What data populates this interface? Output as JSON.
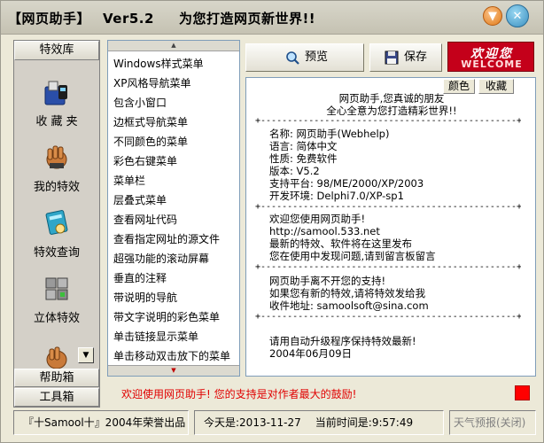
{
  "window": {
    "app_name": "【网页助手】",
    "version": "Ver5.2",
    "slogan": "为您打造网页新世界!!"
  },
  "sidebar": {
    "header": "特效库",
    "items": [
      {
        "label": "收 藏 夹",
        "icon": "phone-book-icon"
      },
      {
        "label": "我的特效",
        "icon": "hand-open-icon"
      },
      {
        "label": "特效查询",
        "icon": "book-search-icon"
      },
      {
        "label": "立体特效",
        "icon": "cubes-icon"
      },
      {
        "label": "",
        "icon": "hand-partial-icon"
      }
    ],
    "footer_buttons": [
      "帮助箱",
      "工具箱"
    ]
  },
  "effect_list": {
    "items": [
      "Windows样式菜单",
      "XP风格导航菜单",
      "包含小窗口",
      "边框式导航菜单",
      "不同颜色的菜单",
      "彩色右键菜单",
      "菜单栏",
      "层叠式菜单",
      "查看网址代码",
      "查看指定网址的源文件",
      "超强功能的滚动屏幕",
      "垂直的注释",
      "带说明的导航",
      "带文字说明的彩色菜单",
      "单击链接显示菜单",
      "单击移动双击放下的菜单"
    ]
  },
  "toolbar": {
    "preview_label": "预览",
    "save_label": "保存",
    "banner_text": "欢迎您",
    "banner_sub": "WELCOME"
  },
  "panel": {
    "tabs": [
      "颜色",
      "收藏"
    ],
    "separator": "+------------------------------------------------+",
    "intro": [
      "网页助手,您真诚的朋友",
      "全心全意为您打造精彩世界!!"
    ],
    "info": [
      "名称: 网页助手(Webhelp)",
      "语言: 简体中文",
      "性质: 免费软件",
      "版本: V5.2",
      "支持平台: 98/ME/2000/XP/2003",
      "开发环境: Delphi7.0/XP-sp1"
    ],
    "welcome": [
      "欢迎您使用网页助手!",
      "http://samool.533.net",
      "最新的特效、软件将在这里发布",
      "您在使用中发现问题,请到留言板留言"
    ],
    "support": [
      "网页助手离不开您的支持!",
      "如果您有新的特效,请将特效发给我",
      "收件地址: samoolsoft@sina.com"
    ],
    "footer": [
      "请用自动升级程序保持特效最新!",
      "2004年06月09日"
    ]
  },
  "message": {
    "text": "欢迎使用网页助手! 您的支持是对作者最大的鼓励!",
    "color": "#e00000"
  },
  "statusbar": {
    "copyright": "『十Samool十』2004年荣誉出品",
    "today_label": "今天是:",
    "today_value": "2013-11-27",
    "time_label": "当前时间是:",
    "time_value": "9:57:49",
    "weather": "天气预报(关闭)"
  }
}
